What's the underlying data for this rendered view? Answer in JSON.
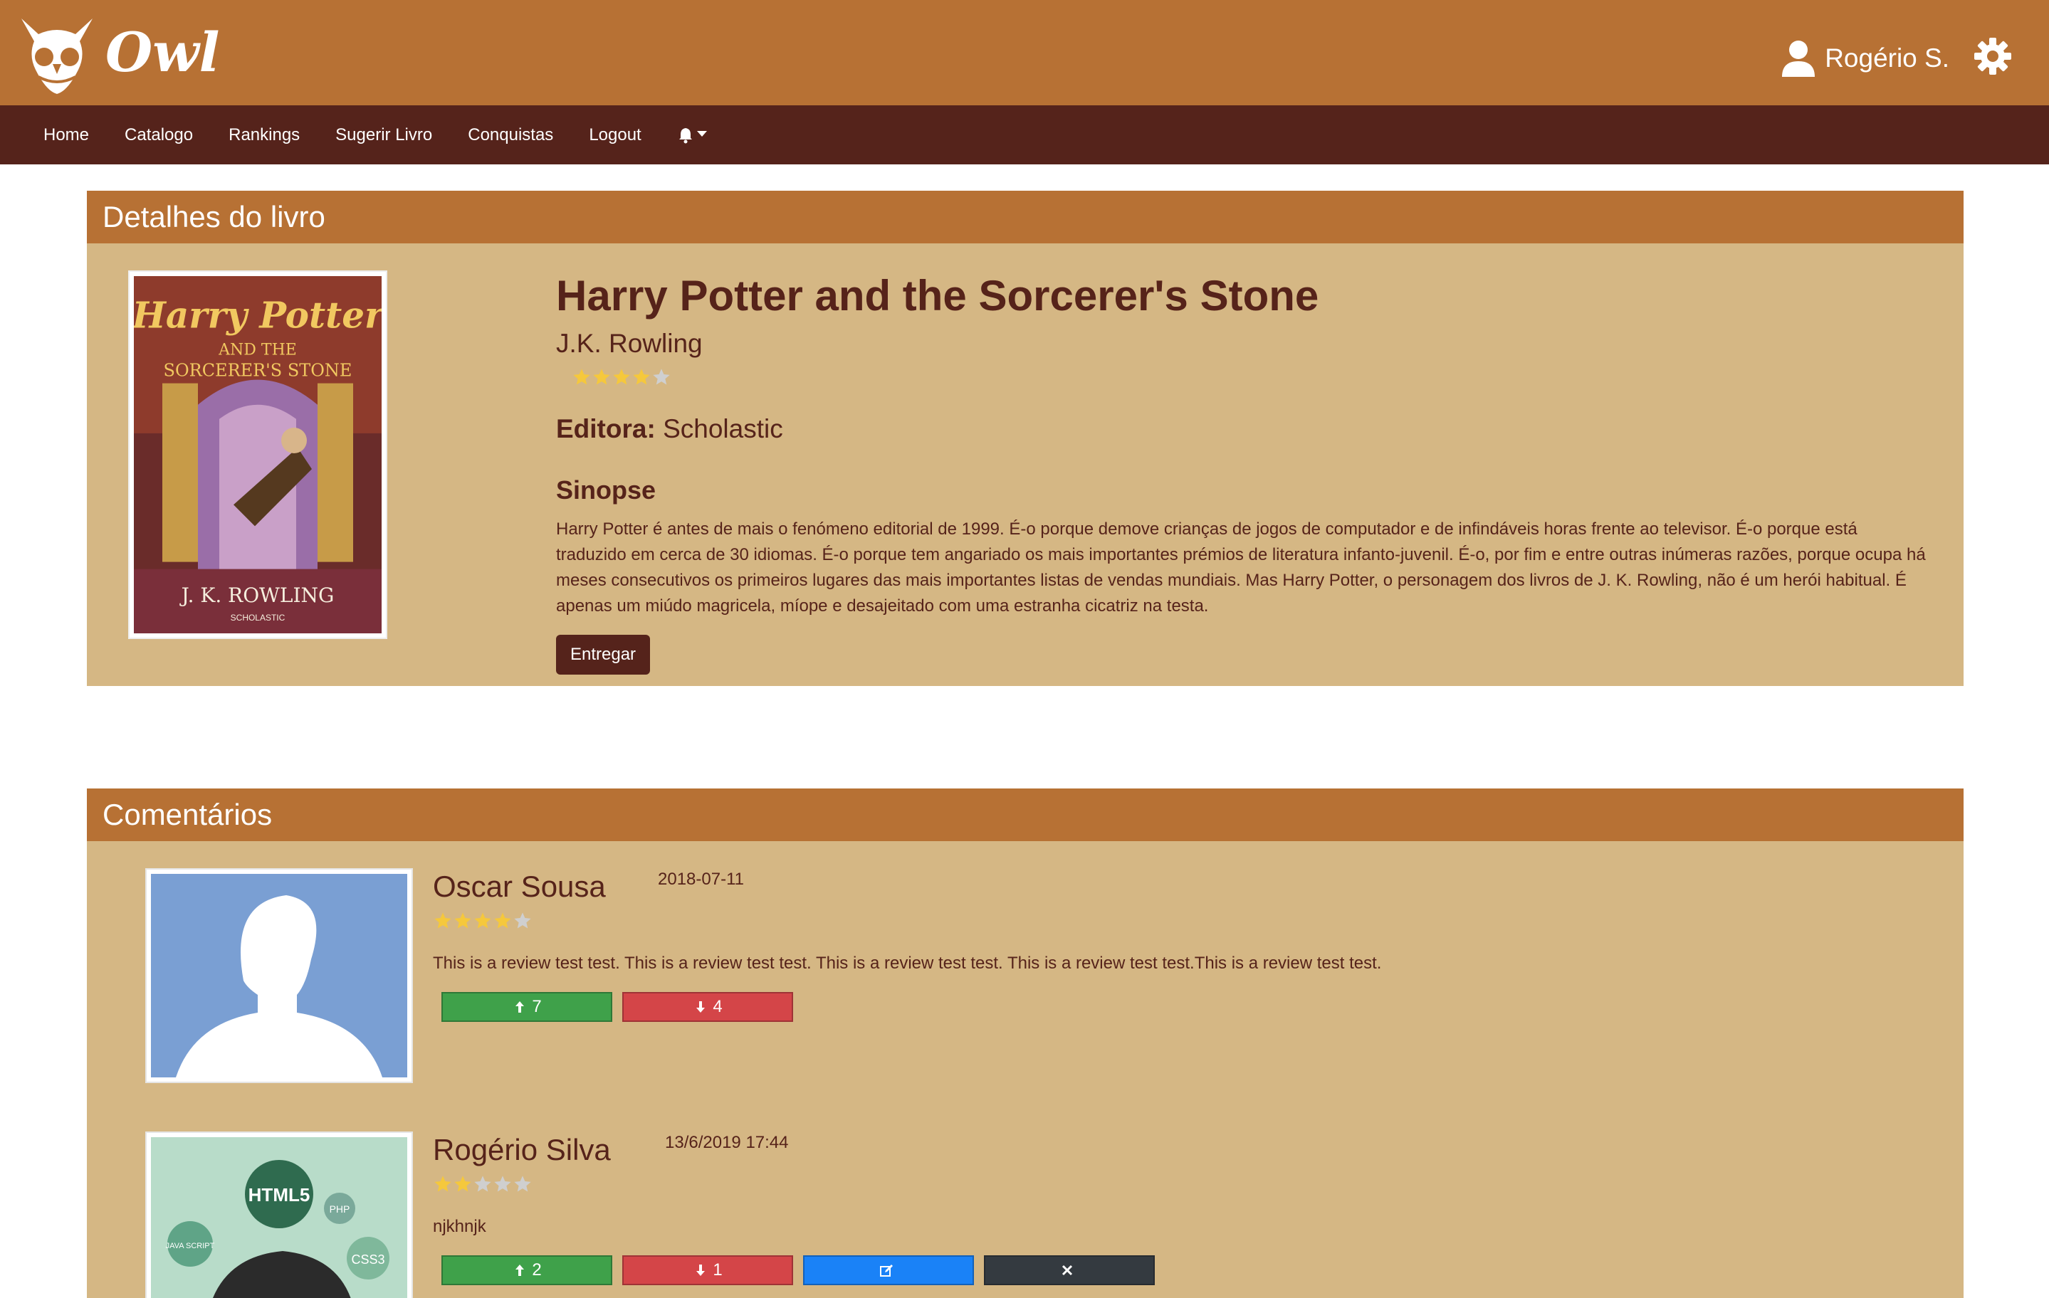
{
  "app": {
    "logo_text": "Owl"
  },
  "user": {
    "name": "Rogério S."
  },
  "nav": {
    "items": [
      "Home",
      "Catalogo",
      "Rankings",
      "Sugerir Livro",
      "Conquistas",
      "Logout"
    ]
  },
  "details": {
    "header": "Detalhes do livro",
    "title": "Harry Potter and the Sorcerer's Stone",
    "author": "J.K. Rowling",
    "rating": 4,
    "rating_max": 5,
    "publisher_label": "Editora:",
    "publisher": "Scholastic",
    "synopsis_heading": "Sinopse",
    "synopsis": "Harry Potter é antes de mais o fenómeno editorial de 1999. É-o porque demove crianças de jogos de computador e de infindáveis horas frente ao televisor. É-o porque está traduzido em cerca de 30 idiomas. É-o porque tem angariado os mais importantes prémios de literatura infanto-juvenil. É-o, por fim e entre outras inúmeras razões, porque ocupa há meses consecutivos os primeiros lugares das mais importantes listas de vendas mundiais. Mas Harry Potter, o personagem dos livros de J. K. Rowling, não é um herói habitual. É apenas um miúdo magricela, míope e desajeitado com uma estranha cicatriz na testa.",
    "deliver_label": "Entregar",
    "cover": {
      "title_line1": "Harry Potter",
      "title_line2": "AND THE",
      "title_line3": "SORCERER'S STONE",
      "author": "J. K. ROWLING",
      "publisher": "SCHOLASTIC"
    }
  },
  "comments": {
    "header": "Comentários",
    "items": [
      {
        "author": "Oscar Sousa",
        "date": "2018-07-11",
        "rating": 4,
        "text": "This is a review test test. This is a review test test. This is a review test test. This is a review test test.This is a review test test.",
        "upvotes": "7",
        "downvotes": "4"
      },
      {
        "author": "Rogério Silva",
        "date": "13/6/2019 17:44",
        "rating": 2,
        "text": "njkhnjk",
        "upvotes": "2",
        "downvotes": "1",
        "avatar_labels": {
          "html": "HTML5",
          "php": "PHP",
          "css": "CSS3",
          "js": "JAVA SCRIPT"
        }
      }
    ]
  },
  "colors": {
    "brand": "#b77134",
    "nav": "#55231b",
    "panel": "#d5b784",
    "star_on": "#f5c83c",
    "star_off": "#cfcfcf"
  }
}
